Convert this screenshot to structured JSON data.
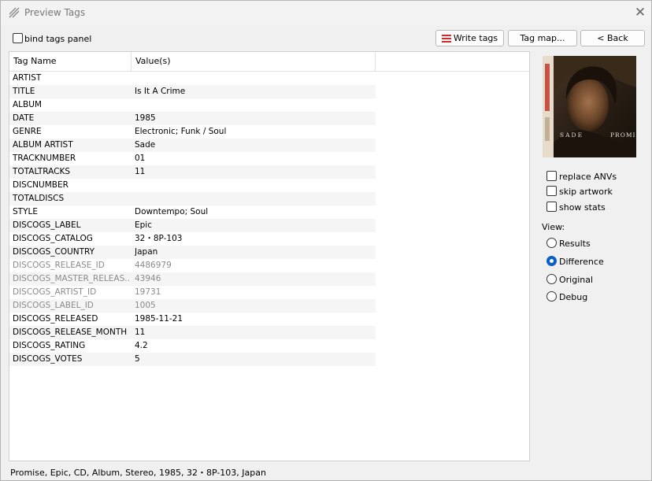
{
  "window": {
    "title": "Preview Tags"
  },
  "toolbar": {
    "bind_label": "bind tags panel",
    "write_label": "Write tags",
    "tagmap_label": "Tag map...",
    "back_label": "< Back"
  },
  "table": {
    "col_name": "Tag Name",
    "col_values": "Value(s)",
    "rows": [
      {
        "name": "ARTIST",
        "value": ""
      },
      {
        "name": "TITLE",
        "value": "Is It A Crime"
      },
      {
        "name": "ALBUM",
        "value": ""
      },
      {
        "name": "DATE",
        "value": "1985"
      },
      {
        "name": "GENRE",
        "value": "Electronic; Funk / Soul"
      },
      {
        "name": "ALBUM ARTIST",
        "value": "Sade"
      },
      {
        "name": "TRACKNUMBER",
        "value": "01"
      },
      {
        "name": "TOTALTRACKS",
        "value": "11"
      },
      {
        "name": "DISCNUMBER",
        "value": ""
      },
      {
        "name": "TOTALDISCS",
        "value": ""
      },
      {
        "name": "STYLE",
        "value": "Downtempo; Soul"
      },
      {
        "name": "DISCOGS_LABEL",
        "value": "Epic"
      },
      {
        "name": "DISCOGS_CATALOG",
        "value": "32・8P-103"
      },
      {
        "name": "DISCOGS_COUNTRY",
        "value": "Japan"
      },
      {
        "name": "DISCOGS_RELEASE_ID",
        "value": "4486979"
      },
      {
        "name": "DISCOGS_MASTER_RELEAS...",
        "value": "43946"
      },
      {
        "name": "DISCOGS_ARTIST_ID",
        "value": "19731"
      },
      {
        "name": "DISCOGS_LABEL_ID",
        "value": "1005"
      },
      {
        "name": "DISCOGS_RELEASED",
        "value": "1985-11-21"
      },
      {
        "name": "DISCOGS_RELEASE_MONTH",
        "value": "11"
      },
      {
        "name": "DISCOGS_RATING",
        "value": "4.2"
      },
      {
        "name": "DISCOGS_VOTES",
        "value": "5"
      }
    ]
  },
  "artwork": {
    "text_artist": "SADE",
    "text_title": "PROMI"
  },
  "options": {
    "replace_anvs": "replace ANVs",
    "skip_artwork": "skip artwork",
    "show_stats": "show stats"
  },
  "view": {
    "label": "View:",
    "results": "Results",
    "difference": "Difference",
    "original": "Original",
    "debug": "Debug",
    "selected": "Difference"
  },
  "status": {
    "text": "Promise, Epic, CD, Album, Stereo, 1985, 32・8P-103, Japan"
  },
  "colors": {
    "accent": "#0a5fc7",
    "write_icon": "#d42a2a"
  }
}
